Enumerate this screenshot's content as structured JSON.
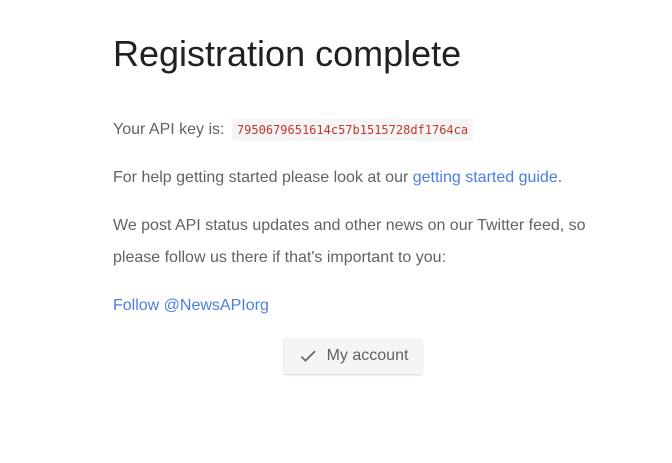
{
  "page": {
    "title": "Registration complete"
  },
  "api_key": {
    "label": "Your API key is:",
    "value": "7950679651614c57b1515728df1764ca"
  },
  "help": {
    "prefix": "For help getting started please look at our ",
    "link_text": "getting started guide",
    "suffix": "."
  },
  "twitter": {
    "text": "We post API status updates and other news on our Twitter feed, so please follow us there if that's important to you:",
    "follow_link": "Follow @NewsAPIorg"
  },
  "account_button": {
    "label": "My account",
    "icon": "check-icon"
  },
  "colors": {
    "link": "#4a7fe0",
    "code_text": "#c0392b",
    "heading": "#202124",
    "body_text": "#5f6368"
  }
}
